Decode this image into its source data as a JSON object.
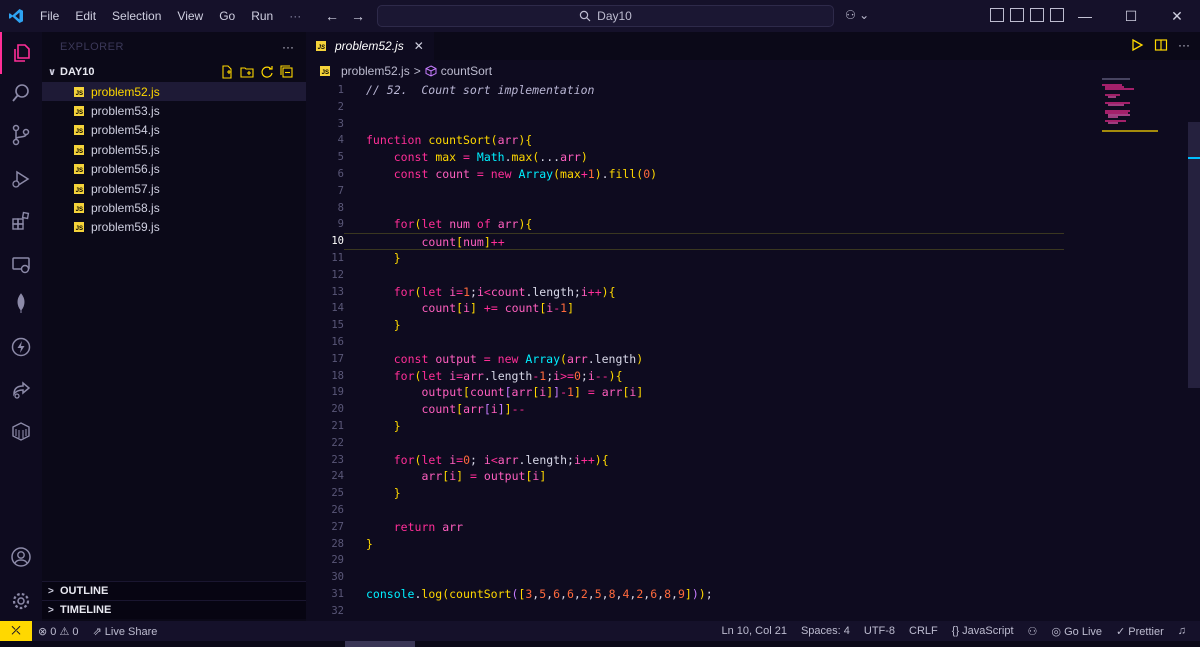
{
  "menu": [
    "File",
    "Edit",
    "Selection",
    "View",
    "Go",
    "Run"
  ],
  "menu_more": "···",
  "search": {
    "text": "Day10"
  },
  "window_controls": {
    "minimize": "—",
    "maximize": "☐",
    "close": "✕"
  },
  "sidebar": {
    "title": "EXPLORER",
    "more": "···",
    "folder": "DAY10",
    "files": [
      "problem52.js",
      "problem53.js",
      "problem54.js",
      "problem55.js",
      "problem56.js",
      "problem57.js",
      "problem58.js",
      "problem59.js"
    ],
    "selected_index": 0,
    "outline": "OUTLINE",
    "timeline": "TIMELINE"
  },
  "editor": {
    "tab": "problem52.js",
    "tab_close": "✕",
    "more": "···",
    "breadcrumb": {
      "file": "problem52.js",
      "sep": ">",
      "symbol": "countSort"
    },
    "current_line": 10,
    "lines": [
      "// 52.  Count sort implementation",
      "",
      "",
      "function countSort(arr){",
      "    const max = Math.max(...arr)",
      "    const count = new Array(max+1).fill(0)",
      "",
      "",
      "    for(let num of arr){",
      "        count[num]++",
      "    }",
      "",
      "    for(let i=1;i<count.length;i++){",
      "        count[i] += count[i-1]",
      "    }",
      "",
      "    const output = new Array(arr.length)",
      "    for(let i=arr.length-1;i>=0;i--){",
      "        output[count[arr[i]]-1] = arr[i]",
      "        count[arr[i]]--",
      "    }",
      "",
      "    for(let i=0; i<arr.length;i++){",
      "        arr[i] = output[i]",
      "    }",
      "",
      "    return arr",
      "}",
      "",
      "",
      "console.log(countSort([3,5,6,6,2,5,8,4,2,6,8,9]));",
      ""
    ]
  },
  "statusbar": {
    "problems": "⊗ 0 ⚠ 0",
    "live_share": "Live Share",
    "position": "Ln 10, Col 21",
    "spaces": "Spaces: 4",
    "encoding": "UTF-8",
    "eol": "CRLF",
    "language": "{} JavaScript",
    "go_live": "Go Live",
    "prettier": "✓ Prettier"
  },
  "colors": {
    "accent": "#ff2e97",
    "keyword": "#ff2e97",
    "function": "#ffd800",
    "class": "#00f0ff",
    "status_remote": "#ffd800"
  }
}
